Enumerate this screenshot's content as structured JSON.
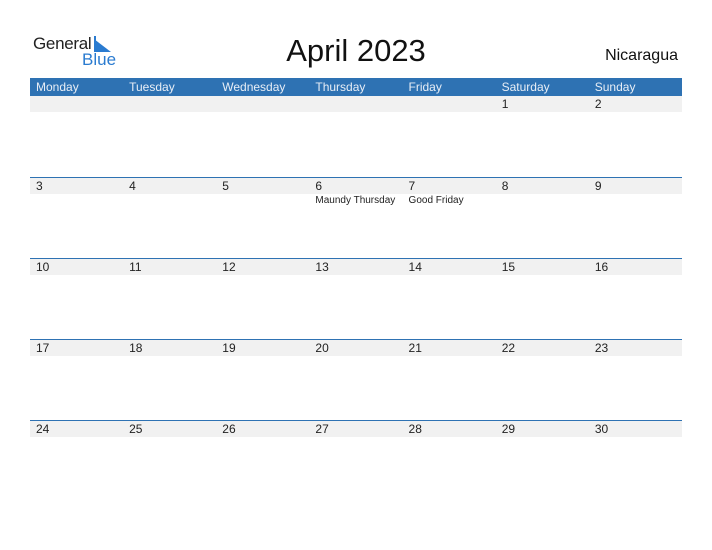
{
  "logo": {
    "general": "General",
    "blue": "Blue"
  },
  "title": "April 2023",
  "country": "Nicaragua",
  "colors": {
    "accent": "#2e72b3",
    "band": "#f1f1f1",
    "logo_blue": "#2a7bd0"
  },
  "weekdays": [
    "Monday",
    "Tuesday",
    "Wednesday",
    "Thursday",
    "Friday",
    "Saturday",
    "Sunday"
  ],
  "weeks": [
    {
      "days": [
        {
          "n": "",
          "h": ""
        },
        {
          "n": "",
          "h": ""
        },
        {
          "n": "",
          "h": ""
        },
        {
          "n": "",
          "h": ""
        },
        {
          "n": "",
          "h": ""
        },
        {
          "n": "1",
          "h": ""
        },
        {
          "n": "2",
          "h": ""
        }
      ]
    },
    {
      "days": [
        {
          "n": "3",
          "h": ""
        },
        {
          "n": "4",
          "h": ""
        },
        {
          "n": "5",
          "h": ""
        },
        {
          "n": "6",
          "h": "Maundy Thursday"
        },
        {
          "n": "7",
          "h": "Good Friday"
        },
        {
          "n": "8",
          "h": ""
        },
        {
          "n": "9",
          "h": ""
        }
      ]
    },
    {
      "days": [
        {
          "n": "10",
          "h": ""
        },
        {
          "n": "11",
          "h": ""
        },
        {
          "n": "12",
          "h": ""
        },
        {
          "n": "13",
          "h": ""
        },
        {
          "n": "14",
          "h": ""
        },
        {
          "n": "15",
          "h": ""
        },
        {
          "n": "16",
          "h": ""
        }
      ]
    },
    {
      "days": [
        {
          "n": "17",
          "h": ""
        },
        {
          "n": "18",
          "h": ""
        },
        {
          "n": "19",
          "h": ""
        },
        {
          "n": "20",
          "h": ""
        },
        {
          "n": "21",
          "h": ""
        },
        {
          "n": "22",
          "h": ""
        },
        {
          "n": "23",
          "h": ""
        }
      ]
    },
    {
      "days": [
        {
          "n": "24",
          "h": ""
        },
        {
          "n": "25",
          "h": ""
        },
        {
          "n": "26",
          "h": ""
        },
        {
          "n": "27",
          "h": ""
        },
        {
          "n": "28",
          "h": ""
        },
        {
          "n": "29",
          "h": ""
        },
        {
          "n": "30",
          "h": ""
        }
      ]
    }
  ]
}
